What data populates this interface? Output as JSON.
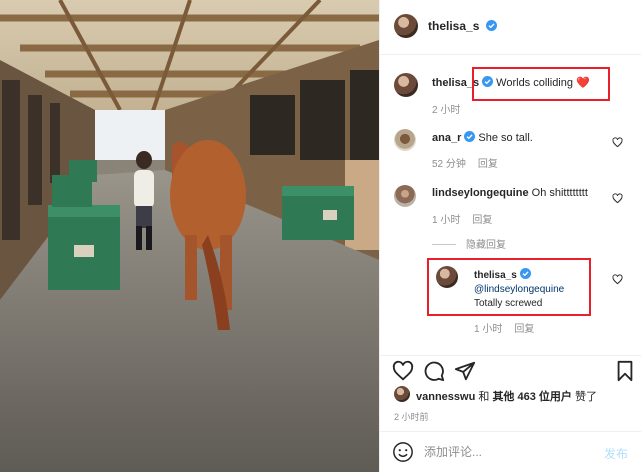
{
  "post": {
    "author": "thelisa_s",
    "caption_author": "thelisa_s",
    "caption": "Worlds colliding",
    "caption_emoji": "❤️",
    "caption_time": "2 小时"
  },
  "comments": [
    {
      "user": "ana_r",
      "text": "She so tall.",
      "time": "52 分钟",
      "reply": "回复"
    },
    {
      "user": "lindseylongequine",
      "text": "Oh shitttttttt",
      "time": "1 小时",
      "reply": "回复"
    }
  ],
  "replies_toggle": "隐藏回复",
  "reply": {
    "user": "thelisa_s",
    "mention": "@lindseylongequine",
    "text": "Totally screwed",
    "time": "1 小时",
    "reply": "回复"
  },
  "likes": {
    "user": "vannesswu",
    "middle": " 和 ",
    "others": "其他 463 位用户",
    "suffix": " 赞了"
  },
  "post_time": "2 小时前",
  "comment_box": {
    "placeholder": "添加评论...",
    "post_label": "发布"
  },
  "icons": {
    "like": "heart-icon",
    "comment": "comment-icon",
    "share": "share-icon",
    "save": "bookmark-icon",
    "emoji": "emoji-icon",
    "verified": "verified-badge-icon"
  },
  "colors": {
    "verified": "#3897f0",
    "highlight_box": "#e8202b",
    "post_button": "#b2dffc"
  }
}
